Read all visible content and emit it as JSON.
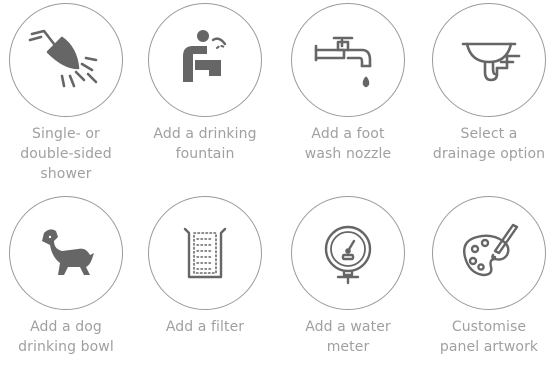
{
  "options": [
    {
      "icon": "shower-head-icon",
      "label_lines": [
        "Single- or",
        "double-sided",
        "shower"
      ]
    },
    {
      "icon": "drinking-fountain-icon",
      "label_lines": [
        "Add a drinking",
        "fountain"
      ]
    },
    {
      "icon": "tap-icon",
      "label_lines": [
        "Add a foot",
        "wash nozzle"
      ]
    },
    {
      "icon": "sink-drain-icon",
      "label_lines": [
        "Select a",
        "drainage option"
      ]
    },
    {
      "icon": "dog-icon",
      "label_lines": [
        "Add a dog",
        "drinking bowl"
      ]
    },
    {
      "icon": "filter-icon",
      "label_lines": [
        "Add a filter"
      ]
    },
    {
      "icon": "water-meter-icon",
      "label_lines": [
        "Add a water",
        "meter"
      ]
    },
    {
      "icon": "paint-palette-icon",
      "label_lines": [
        "Customise",
        "panel artwork"
      ]
    }
  ],
  "colors": {
    "icon": "#666666",
    "ring": "#9a9a9a",
    "label": "#a0a0a0"
  }
}
